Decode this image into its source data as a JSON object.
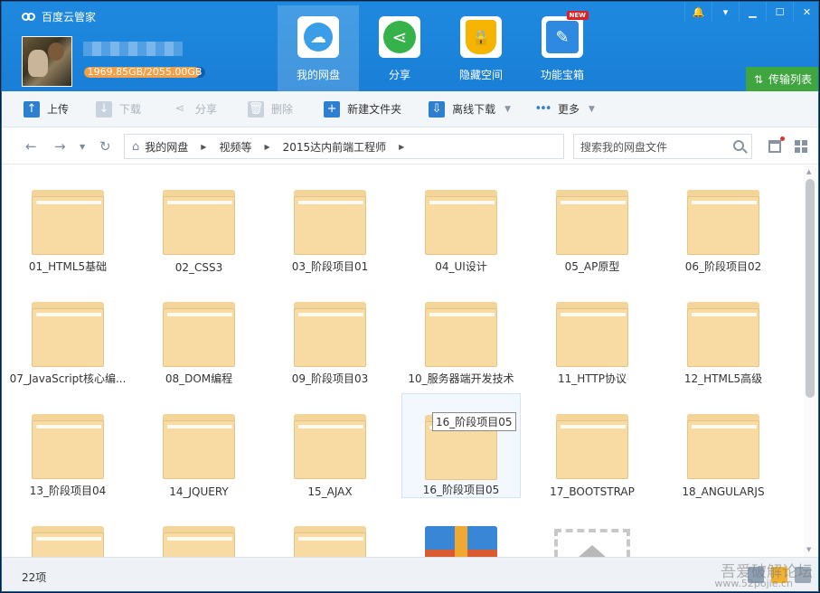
{
  "app": {
    "title": "百度云管家"
  },
  "window_controls": [
    "bell-icon",
    "dropdown-icon",
    "minimize-icon",
    "maximize-icon",
    "close-icon"
  ],
  "user": {
    "quota_text": "1969.85GB/2055.00GB",
    "quota_fraction": 0.958
  },
  "nav": {
    "items": [
      {
        "label": "我的网盘",
        "icon": "cloud-disk-icon",
        "active": true
      },
      {
        "label": "分享",
        "icon": "share-icon",
        "active": false
      },
      {
        "label": "隐藏空间",
        "icon": "lock-icon",
        "active": false
      },
      {
        "label": "功能宝箱",
        "icon": "tools-icon",
        "active": false,
        "badge": "NEW"
      }
    ],
    "transfer_label": "传输列表"
  },
  "toolbar": {
    "upload": "上传",
    "download": "下载",
    "share": "分享",
    "delete": "删除",
    "new_folder": "新建文件夹",
    "offline_download": "离线下载",
    "more": "更多"
  },
  "breadcrumb": {
    "items": [
      "我的网盘",
      "视频等",
      "2015达内前端工程师"
    ]
  },
  "search": {
    "placeholder": "搜索我的网盘文件"
  },
  "files": [
    "01_HTML5基础",
    "02_CSS3",
    "03_阶段项目01",
    "04_UI设计",
    "05_AP原型",
    "06_阶段项目02",
    "07_JavaScript核心编...",
    "08_DOM编程",
    "09_阶段项目03",
    "10_服务器端开发技术",
    "11_HTTP协议",
    "12_HTML5高级",
    "13_阶段项目04",
    "14_JQUERY",
    "15_AJAX",
    "16_阶段项目05",
    "17_BOOTSTRAP",
    "18_ANGULARJS"
  ],
  "tooltip": "16_阶段项目05",
  "status": {
    "count": "22项"
  },
  "watermark": {
    "text": "吾爱破解论坛",
    "url": "www.52pojie.cn"
  },
  "colors": {
    "header": "#1a7fd6",
    "transfer": "#3fa63f",
    "folder": "#f7dba2",
    "quota": "#f4a04a"
  }
}
